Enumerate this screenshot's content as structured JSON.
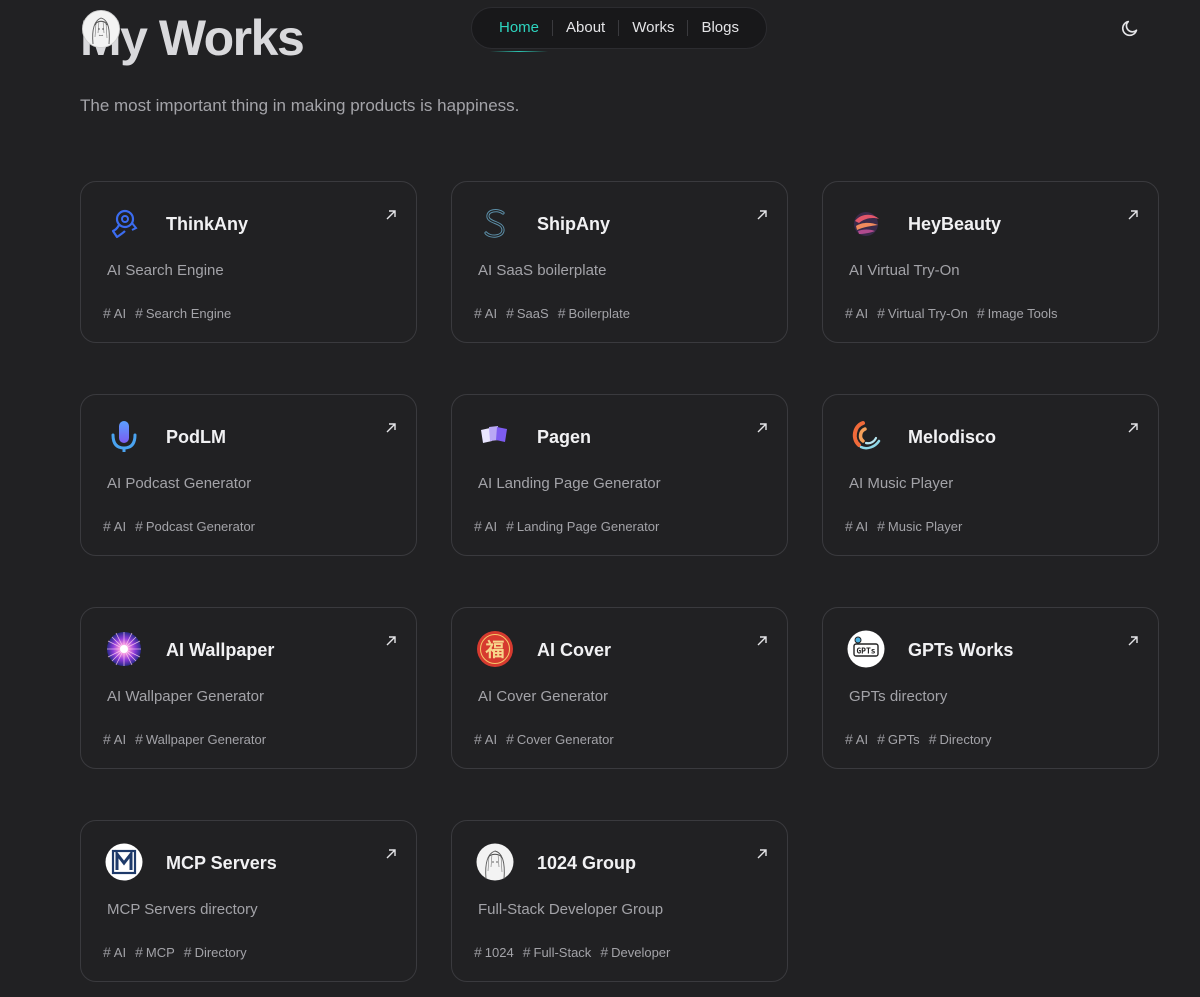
{
  "header": {
    "title": "My Works",
    "subtitle": "The most important thing in making products is happiness."
  },
  "nav": {
    "items": [
      {
        "label": "Home",
        "active": true
      },
      {
        "label": "About",
        "active": false
      },
      {
        "label": "Works",
        "active": false
      },
      {
        "label": "Blogs",
        "active": false
      }
    ],
    "theme_toggle_icon": "moon-icon"
  },
  "colors": {
    "accent": "#2dd4bf",
    "background": "#212123",
    "card_border": "#3a3a3e"
  },
  "works": [
    {
      "name": "ThinkAny",
      "description": "AI Search Engine",
      "tags": [
        "AI",
        "Search Engine"
      ],
      "icon": "thinkany-logo"
    },
    {
      "name": "ShipAny",
      "description": "AI SaaS boilerplate",
      "tags": [
        "AI",
        "SaaS",
        "Boilerplate"
      ],
      "icon": "shipany-logo"
    },
    {
      "name": "HeyBeauty",
      "description": "AI Virtual Try-On",
      "tags": [
        "AI",
        "Virtual Try-On",
        "Image Tools"
      ],
      "icon": "heybeauty-logo"
    },
    {
      "name": "PodLM",
      "description": "AI Podcast Generator",
      "tags": [
        "AI",
        "Podcast Generator"
      ],
      "icon": "podlm-logo"
    },
    {
      "name": "Pagen",
      "description": "AI Landing Page Generator",
      "tags": [
        "AI",
        "Landing Page Generator"
      ],
      "icon": "pagen-logo"
    },
    {
      "name": "Melodisco",
      "description": "AI Music Player",
      "tags": [
        "AI",
        "Music Player"
      ],
      "icon": "melodisco-logo"
    },
    {
      "name": "AI Wallpaper",
      "description": "AI Wallpaper Generator",
      "tags": [
        "AI",
        "Wallpaper Generator"
      ],
      "icon": "ai-wallpaper-logo"
    },
    {
      "name": "AI Cover",
      "description": "AI Cover Generator",
      "tags": [
        "AI",
        "Cover Generator"
      ],
      "icon": "ai-cover-logo"
    },
    {
      "name": "GPTs Works",
      "description": "GPTs directory",
      "tags": [
        "AI",
        "GPTs",
        "Directory"
      ],
      "icon": "gpts-works-logo"
    },
    {
      "name": "MCP Servers",
      "description": "MCP Servers directory",
      "tags": [
        "AI",
        "MCP",
        "Directory"
      ],
      "icon": "mcp-servers-logo"
    },
    {
      "name": "1024 Group",
      "description": "Full-Stack Developer Group",
      "tags": [
        "1024",
        "Full-Stack",
        "Developer"
      ],
      "icon": "1024-group-logo"
    }
  ]
}
